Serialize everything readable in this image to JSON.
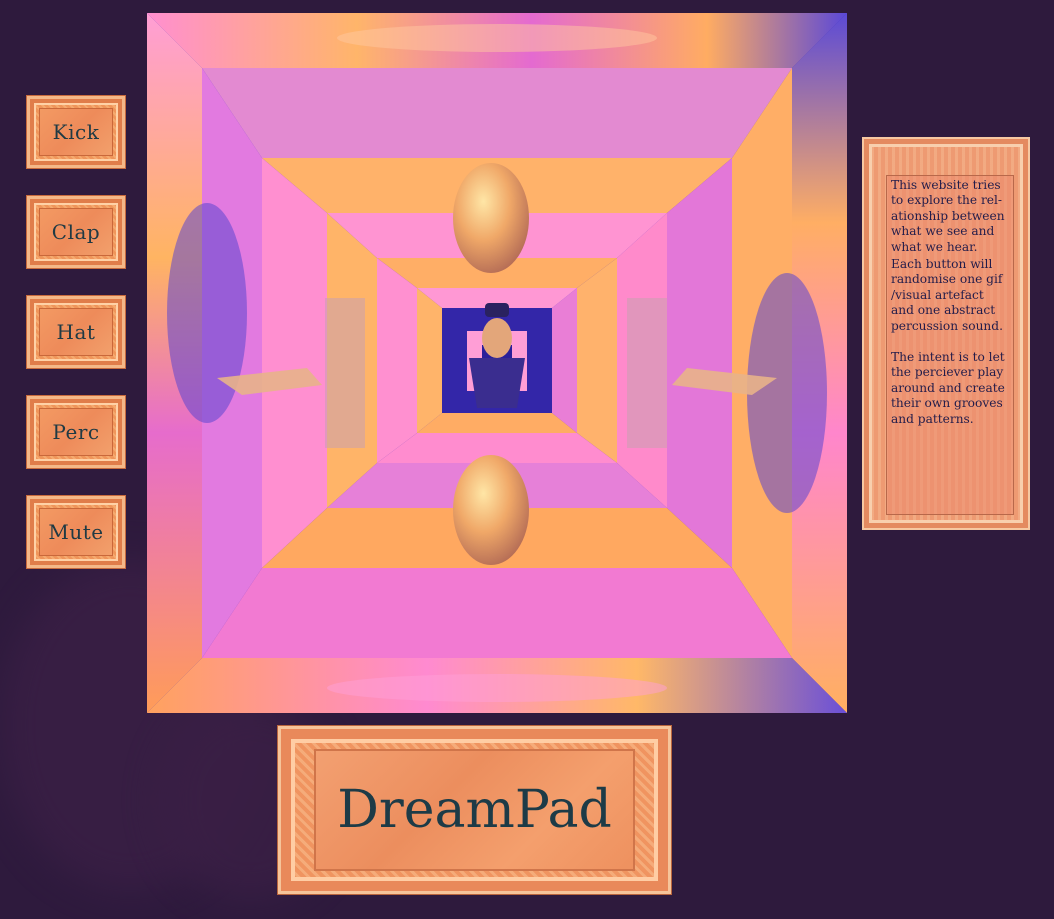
{
  "buttons": [
    {
      "label": "Kick"
    },
    {
      "label": "Clap"
    },
    {
      "label": "Hat"
    },
    {
      "label": "Perc"
    },
    {
      "label": "Mute"
    }
  ],
  "info": {
    "paragraph1": "This website tries to explore the rel-ationship between what we see and what we hear.",
    "paragraph2": "Each button will randomise one gif /visual artefact and one abstract percussion sound.",
    "paragraph3": "The intent is to let the perciever play around and create their own grooves and patterns."
  },
  "title": "DreamPad",
  "colors": {
    "background": "#2e1a3d",
    "button_fill": "#f0955a",
    "text_dark": "#1f3a44",
    "visual_pink": "#ff7fc8",
    "visual_orange": "#ffb060",
    "visual_blue": "#3c2fb0"
  }
}
